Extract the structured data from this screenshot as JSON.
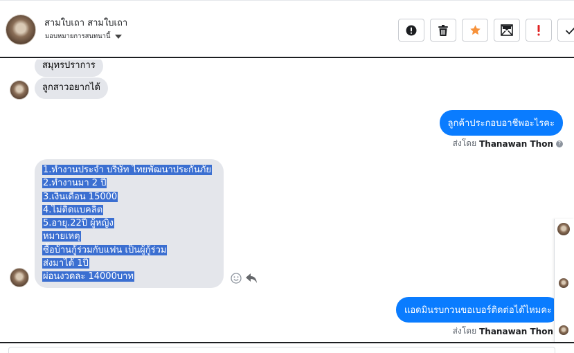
{
  "header": {
    "contact_name": "สามใบเถา สามใบเถา",
    "assign_label": "มอบหมายการสนทนานี้",
    "actions": [
      {
        "name": "report-button",
        "icon": "exclamation-circle-icon"
      },
      {
        "name": "delete-button",
        "icon": "trash-icon"
      },
      {
        "name": "star-button",
        "icon": "star-icon",
        "color": "#f7923b"
      },
      {
        "name": "mark-unread-button",
        "icon": "envelope-icon"
      },
      {
        "name": "spam-button",
        "icon": "exclamation-icon",
        "color": "#e02424"
      },
      {
        "name": "done-button",
        "icon": "check-icon"
      }
    ]
  },
  "thread": {
    "messages_in": [
      {
        "text": "สมุทรปราการ"
      },
      {
        "text": "ลูกสาวอยากได้"
      }
    ],
    "message_out_1": {
      "text": "ลูกค้าประกอบอาชีพอะไรคะ",
      "sent_by_label": "ส่งโดย",
      "sender": "Thanawan Thon"
    },
    "big_message_lines": [
      "1.ทำงานประจำ บริษัท ไทยพัฒนาประกันภัย",
      "2.ทำงานมา 2 ปี",
      "3.เงินเดือน 15000",
      "4.ไม่ติดแบคลิต",
      "5.อายุ.22ปี ผู้หญิง",
      "หมายเหตุ",
      "ซื้อบ้านกู้ร่วมกับแฟน เป็นผู้กู้ร่วม",
      "ส่งมาได้ 1ปี",
      "ผ่อนงวดละ 14000บาท"
    ],
    "message_out_2": {
      "text": "แอดมินรบกวนขอเบอร์ติดต่อได้ไหมคะ",
      "sent_by_label": "ส่งโดย",
      "sender": "Thanawan Thon"
    }
  },
  "colors": {
    "outgoing_bubble": "#0a7cff",
    "incoming_bubble": "#e4e6eb",
    "selection": "#3b6fd1"
  }
}
